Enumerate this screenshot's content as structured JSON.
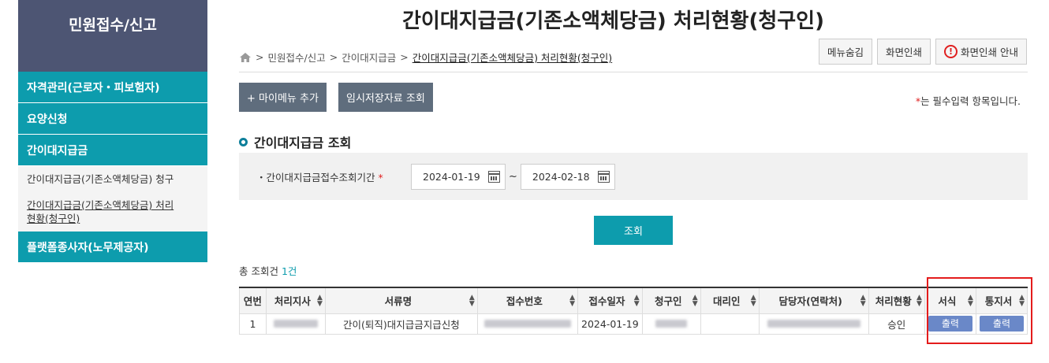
{
  "sidebar": {
    "header": "민원접수/신고",
    "cats": [
      {
        "label": "자격관리(근로자・피보험자)"
      },
      {
        "label": "요양신청"
      },
      {
        "label": "간이대지급금"
      }
    ],
    "sub_items": [
      {
        "label": "간이대지급금(기존소액체당금) 청구"
      },
      {
        "label": "간이대지급금(기존소액체당금) 처리현황(청구인)"
      }
    ],
    "last_cat": "플랫폼종사자(노무제공자)"
  },
  "title": "간이대지급금(기존소액체당금) 처리현황(청구인)",
  "breadcrumb": {
    "items": [
      "민원접수/신고",
      "간이대지급금",
      "간이대지급금(기존소액체당금) 처리현황(청구인)"
    ]
  },
  "top_buttons": {
    "hide_menu": "메뉴숨김",
    "print": "화면인쇄",
    "print_guide": "화면인쇄 안내"
  },
  "buttons": {
    "add_mymenu": "+ 마이메뉴 추가",
    "temp_saved": "임시저장자료 조회"
  },
  "required_note": {
    "star": "*",
    "text": "는 필수입력 항목입니다."
  },
  "section": {
    "title": "간이대지급금 조회"
  },
  "search": {
    "label": "・간이대지급금접수조회기간",
    "star": "*",
    "date_from": "2024-01-19",
    "separator": "~",
    "date_to": "2024-02-18",
    "button": "조회"
  },
  "total": {
    "prefix": "총 조회건",
    "count": "1건"
  },
  "table": {
    "headers": [
      "연번",
      "처리지사",
      "서류명",
      "접수번호",
      "접수일자",
      "청구인",
      "대리인",
      "담당자(연락처)",
      "처리현황",
      "서식",
      "통지서"
    ],
    "row": {
      "no": "1",
      "doc": "간이(퇴직)대지급금지급신청",
      "date": "2024-01-19",
      "status": "승인",
      "form_btn": "출력",
      "notice_btn": "출력"
    }
  },
  "colors": {
    "accent": "#0d9cad",
    "sidebar_header": "#4d5573",
    "dark_button": "#5f6d7d",
    "highlight": "#e41c1c"
  }
}
